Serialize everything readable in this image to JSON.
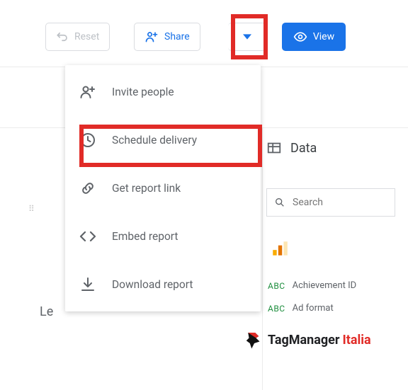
{
  "toolbar": {
    "reset_label": "Reset",
    "share_label": "Share",
    "view_label": "View"
  },
  "menu": {
    "items": [
      {
        "id": "invite-people",
        "label": "Invite people"
      },
      {
        "id": "schedule-delivery",
        "label": "Schedule delivery"
      },
      {
        "id": "get-report-link",
        "label": "Get report link"
      },
      {
        "id": "embed-report",
        "label": "Embed report"
      },
      {
        "id": "download-report",
        "label": "Download report"
      }
    ]
  },
  "panel": {
    "data_heading": "Data",
    "search_placeholder": "Search",
    "fields": [
      {
        "type": "ABC",
        "label": "Achievement ID"
      },
      {
        "type": "ABC",
        "label": "Ad format"
      }
    ]
  },
  "truncated": {
    "le": "Le"
  },
  "branding": {
    "prefix": "TagManager",
    "suffix": "Italia"
  }
}
